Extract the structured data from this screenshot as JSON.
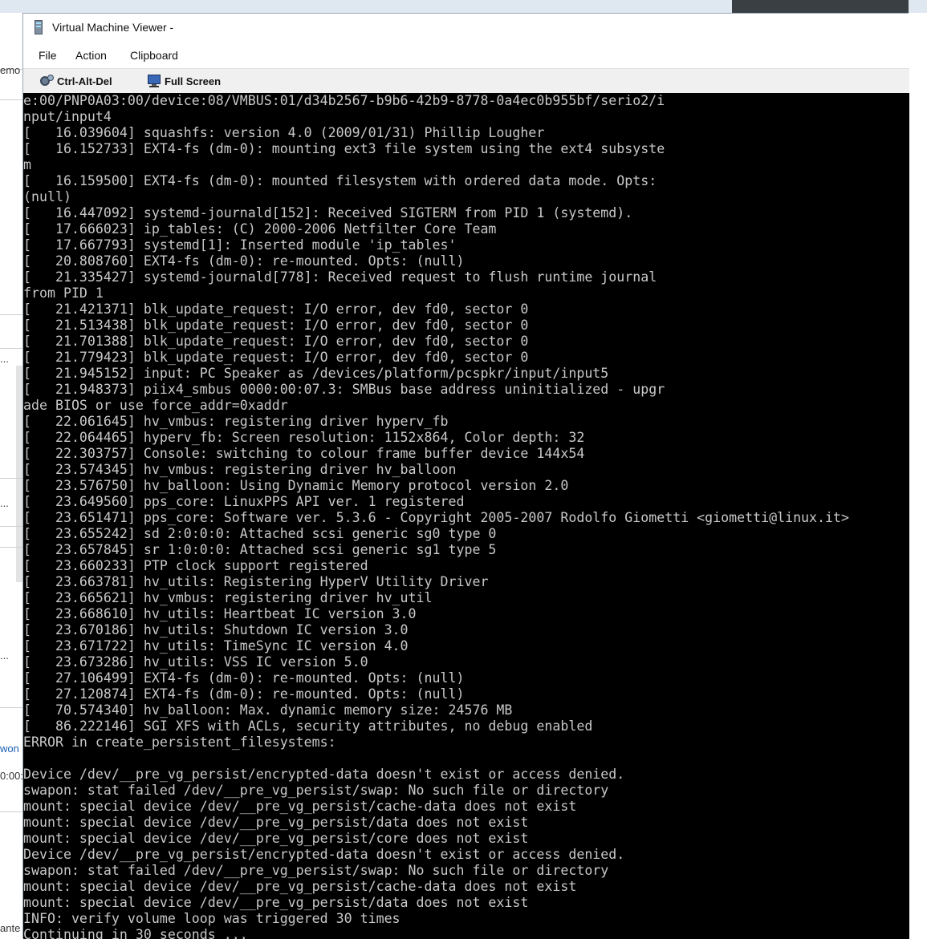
{
  "window": {
    "title": "Virtual Machine Viewer -"
  },
  "menu": {
    "file": "File",
    "action": "Action",
    "clipboard": "Clipboard"
  },
  "toolbar": {
    "ctrl_alt_del": "Ctrl-Alt-Del",
    "full_screen": "Full Screen"
  },
  "background_fragments": {
    "frag1": "emo",
    "frag2": "...",
    "frag3": "...",
    "frag4": "...",
    "frag5": "won",
    "frag6": "0:00:",
    "frag7": "ante"
  },
  "console": {
    "text": "e:00/PNP0A03:00/device:08/VMBUS:01/d34b2567-b9b6-42b9-8778-0a4ec0b955bf/serio2/i\nnput/input4\n[   16.039604] squashfs: version 4.0 (2009/01/31) Phillip Lougher\n[   16.152733] EXT4-fs (dm-0): mounting ext3 file system using the ext4 subsyste\nm\n[   16.159500] EXT4-fs (dm-0): mounted filesystem with ordered data mode. Opts:\n(null)\n[   16.447092] systemd-journald[152]: Received SIGTERM from PID 1 (systemd).\n[   17.666023] ip_tables: (C) 2000-2006 Netfilter Core Team\n[   17.667793] systemd[1]: Inserted module 'ip_tables'\n[   20.808760] EXT4-fs (dm-0): re-mounted. Opts: (null)\n[   21.335427] systemd-journald[778]: Received request to flush runtime journal\nfrom PID 1\n[   21.421371] blk_update_request: I/O error, dev fd0, sector 0\n[   21.513438] blk_update_request: I/O error, dev fd0, sector 0\n[   21.701388] blk_update_request: I/O error, dev fd0, sector 0\n[   21.779423] blk_update_request: I/O error, dev fd0, sector 0\n[   21.945152] input: PC Speaker as /devices/platform/pcspkr/input/input5\n[   21.948373] piix4_smbus 0000:00:07.3: SMBus base address uninitialized - upgr\nade BIOS or use force_addr=0xaddr\n[   22.061645] hv_vmbus: registering driver hyperv_fb\n[   22.064465] hyperv_fb: Screen resolution: 1152x864, Color depth: 32\n[   22.303757] Console: switching to colour frame buffer device 144x54\n[   23.574345] hv_vmbus: registering driver hv_balloon\n[   23.576750] hv_balloon: Using Dynamic Memory protocol version 2.0\n[   23.649560] pps_core: LinuxPPS API ver. 1 registered\n[   23.651471] pps_core: Software ver. 5.3.6 - Copyright 2005-2007 Rodolfo Giometti <giometti@linux.it>\n[   23.655242] sd 2:0:0:0: Attached scsi generic sg0 type 0\n[   23.657845] sr 1:0:0:0: Attached scsi generic sg1 type 5\n[   23.660233] PTP clock support registered\n[   23.663781] hv_utils: Registering HyperV Utility Driver\n[   23.665621] hv_vmbus: registering driver hv_util\n[   23.668610] hv_utils: Heartbeat IC version 3.0\n[   23.670186] hv_utils: Shutdown IC version 3.0\n[   23.671722] hv_utils: TimeSync IC version 4.0\n[   23.673286] hv_utils: VSS IC version 5.0\n[   27.106499] EXT4-fs (dm-0): re-mounted. Opts: (null)\n[   27.120874] EXT4-fs (dm-0): re-mounted. Opts: (null)\n[   70.574340] hv_balloon: Max. dynamic memory size: 24576 MB\n[   86.222146] SGI XFS with ACLs, security attributes, no debug enabled\nERROR in create_persistent_filesystems:\n\nDevice /dev/__pre_vg_persist/encrypted-data doesn't exist or access denied.\nswapon: stat failed /dev/__pre_vg_persist/swap: No such file or directory\nmount: special device /dev/__pre_vg_persist/cache-data does not exist\nmount: special device /dev/__pre_vg_persist/data does not exist\nmount: special device /dev/__pre_vg_persist/core does not exist\nDevice /dev/__pre_vg_persist/encrypted-data doesn't exist or access denied.\nswapon: stat failed /dev/__pre_vg_persist/swap: No such file or directory\nmount: special device /dev/__pre_vg_persist/cache-data does not exist\nmount: special device /dev/__pre_vg_persist/data does not exist\nINFO: verify volume loop was triggered 30 times\nContinuing in 30 seconds ..."
  }
}
